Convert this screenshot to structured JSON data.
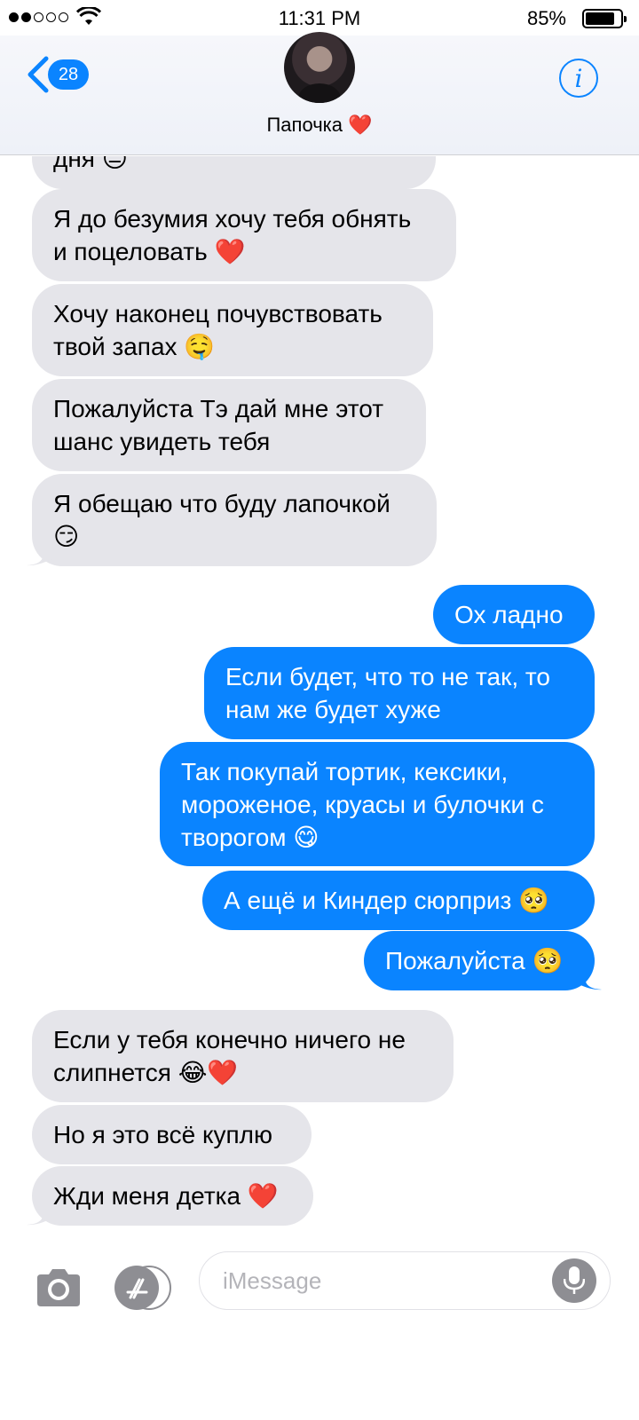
{
  "status_bar": {
    "time": "11:31 PM",
    "battery_percent": "85%",
    "battery_level": 0.85,
    "signal_bars_filled": 2,
    "signal_bars_total": 5
  },
  "header": {
    "back_count": "28",
    "contact_name": "Папочка ❤️",
    "info_label": "i"
  },
  "messages": [
    {
      "dir": "in",
      "text": "дня 😐"
    },
    {
      "dir": "in",
      "text": "Я до безумия хочу тебя обнять\nи поцеловать ❤️"
    },
    {
      "dir": "in",
      "text": "Хочу наконец почувствовать\nтвой запах 🤤"
    },
    {
      "dir": "in",
      "text": "Пожалуйста Тэ дай мне этот\nшанс увидеть тебя"
    },
    {
      "dir": "in",
      "text": "Я обещаю что буду лапочкой\n😏"
    },
    {
      "dir": "out",
      "text": "Ох ладно"
    },
    {
      "dir": "out",
      "text": "Если будет, что то не так, то\nнам же будет хуже"
    },
    {
      "dir": "out",
      "text": "Так покупай тортик, кексики,\nмороженое, круасы и булочки с\nтворогом 😋"
    },
    {
      "dir": "out",
      "text": "А ещё и Киндер сюрприз 🥺"
    },
    {
      "dir": "out",
      "text": "Пожалуйста 🥺"
    },
    {
      "dir": "in",
      "text": "Если у тебя конечно ничего не\nслипнется 😂❤️"
    },
    {
      "dir": "in",
      "text": "Но я это всё куплю"
    },
    {
      "dir": "in",
      "text": "Жди меня детка ❤️"
    }
  ],
  "composer": {
    "placeholder": "iMessage"
  },
  "colors": {
    "accent": "#0a84ff",
    "incoming_bubble": "#e5e5ea",
    "outgoing_text": "#ffffff"
  }
}
